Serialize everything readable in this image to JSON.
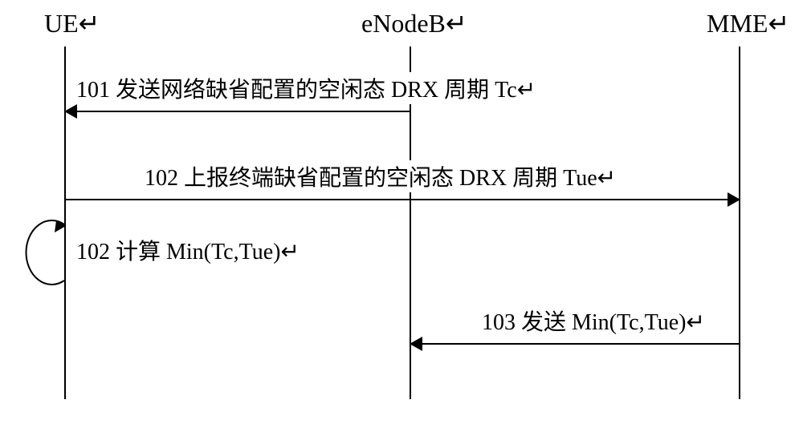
{
  "actors": {
    "ue": "UE",
    "enodeb": "eNodeB",
    "mme": "MME"
  },
  "eol": "↵",
  "messages": {
    "m101": "101 发送网络缺省配置的空闲态 DRX 周期 Tc",
    "m102_report": "102 上报终端缺省配置的空闲态 DRX 周期 Tue",
    "m102_calc": "102 计算 Min(Tc,Tue)",
    "m103": "103 发送 Min(Tc,Tue)"
  }
}
